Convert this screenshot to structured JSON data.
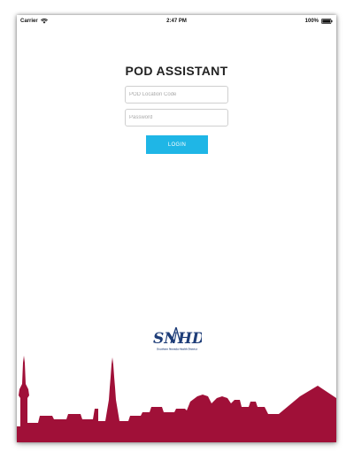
{
  "status_bar": {
    "carrier": "Carrier",
    "time": "2:47 PM",
    "battery": "100%"
  },
  "app": {
    "title": "POD ASSISTANT"
  },
  "form": {
    "location_placeholder": "POD Location Code",
    "location_value": "",
    "password_placeholder": "Password",
    "password_value": "",
    "login_label": "LOGIN"
  },
  "logo": {
    "mark": "SNHD",
    "tagline": "Southern Nevada Health District"
  },
  "colors": {
    "accent": "#1fb6e6",
    "skyline": "#a01038",
    "logo": "#1e3d78"
  },
  "icons": [
    "wifi-icon",
    "battery-icon"
  ]
}
